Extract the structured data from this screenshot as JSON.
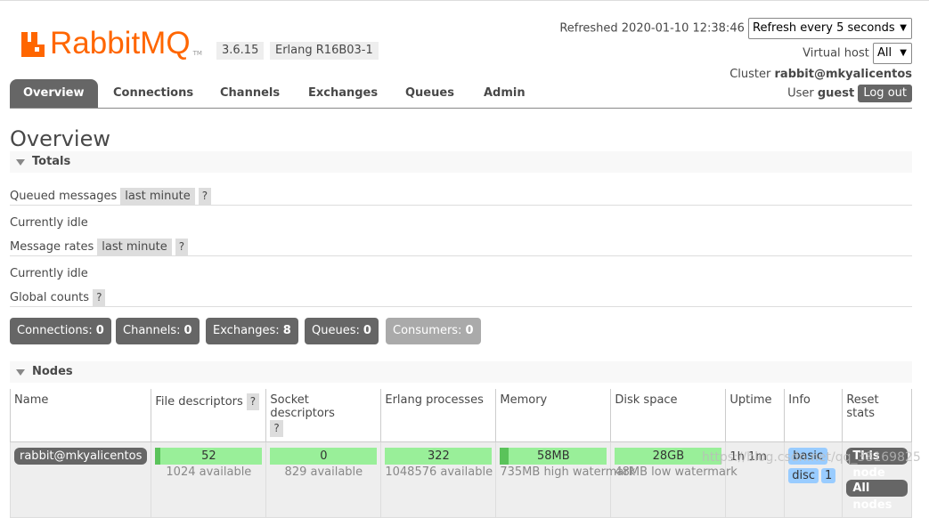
{
  "header": {
    "brand": "RabbitMQ",
    "brand_tm": "TM",
    "version": "3.6.15",
    "erlang": "Erlang R16B03-1",
    "refreshed_label": "Refreshed 2020-01-10 12:38:46",
    "refresh_select": "Refresh every 5 seconds",
    "virtual_host_label": "Virtual host",
    "virtual_host_value": "All",
    "cluster_label": "Cluster",
    "cluster_value": "rabbit@mkyalicentos",
    "user_label": "User",
    "user_value": "guest",
    "logout_label": "Log out"
  },
  "tabs": [
    "Overview",
    "Connections",
    "Channels",
    "Exchanges",
    "Queues",
    "Admin"
  ],
  "active_tab": "Overview",
  "page_title": "Overview",
  "totals": {
    "section_title": "Totals",
    "queued_messages_label": "Queued messages",
    "queued_messages_range": "last minute",
    "help": "?",
    "currently_idle_1": "Currently idle",
    "message_rates_label": "Message rates",
    "message_rates_range": "last minute",
    "currently_idle_2": "Currently idle",
    "global_counts_label": "Global counts"
  },
  "counters": [
    {
      "label": "Connections:",
      "value": "0"
    },
    {
      "label": "Channels:",
      "value": "0"
    },
    {
      "label": "Exchanges:",
      "value": "8"
    },
    {
      "label": "Queues:",
      "value": "0"
    },
    {
      "label": "Consumers:",
      "value": "0"
    }
  ],
  "nodes": {
    "section_title": "Nodes",
    "headers": [
      "Name",
      "File descriptors",
      "Socket descriptors",
      "Erlang processes",
      "Memory",
      "Disk space",
      "Uptime",
      "Info",
      "Reset stats"
    ],
    "row": {
      "name": "rabbit@mkyalicentos",
      "fd_value": "52",
      "fd_sub": "1024 available",
      "fd_fraction": 0.05,
      "sd_value": "0",
      "sd_sub": "829 available",
      "sd_fraction": 0.0,
      "ep_value": "322",
      "ep_sub": "1048576 available",
      "ep_fraction": 0.0,
      "mem_value": "58MB",
      "mem_sub": "735MB high watermark",
      "mem_fraction": 0.08,
      "disk_value": "28GB",
      "disk_sub": "48MB low watermark",
      "disk_fraction": 0.0,
      "uptime": "1h 1m",
      "info_basic": "basic",
      "info_disc": "disc",
      "info_count": "1",
      "reset_this": "This node",
      "reset_all": "All nodes"
    }
  },
  "watermark": "https://blog.csdn.net/qq_38169825"
}
